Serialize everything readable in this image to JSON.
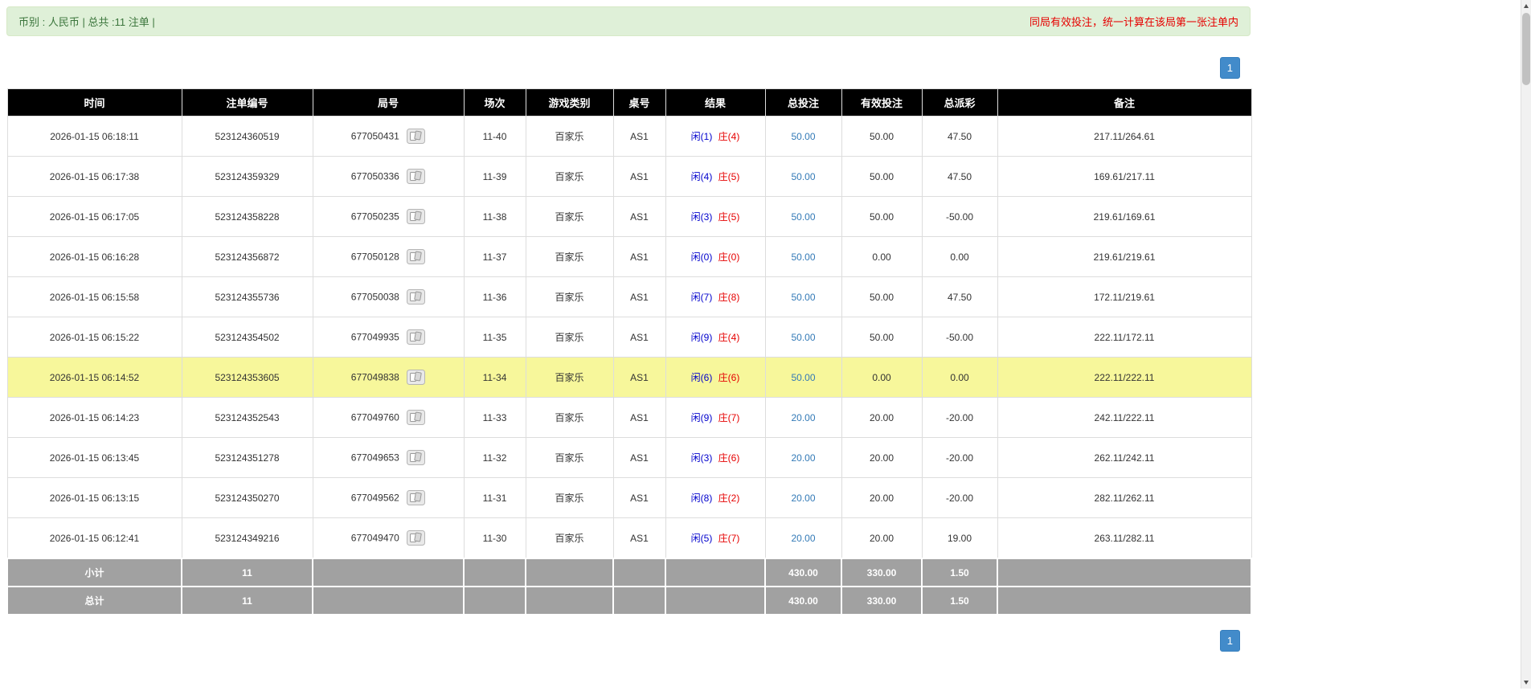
{
  "colors": {
    "topbar_bg": "#dff0d8",
    "topbar_border": "#d6e9c6",
    "topbar_text_green": "#3c763d",
    "notice_red": "#e60000",
    "pagination_blue": "#428bca",
    "header_bg": "#000000",
    "highlight_yellow": "#f7f79b",
    "player_blue": "#0000cc",
    "banker_red": "#e60000",
    "bet_link_blue": "#337ab7",
    "negative_red": "#e60000",
    "summary_gray": "#a1a1a1"
  },
  "topbar": {
    "summary": "币别 : 人民币 | 总共 :11 注单 |",
    "notice": "同局有效投注，统一计算在该局第一张注单内"
  },
  "pagination": {
    "page": "1"
  },
  "table": {
    "headers": [
      "时间",
      "注单编号",
      "局号",
      "场次",
      "游戏类别",
      "桌号",
      "结果",
      "总投注",
      "有效投注",
      "总派彩",
      "备注"
    ],
    "rows": [
      {
        "time": "2026-01-15 06:18:11",
        "bet_id": "523124360519",
        "round": "677050431",
        "session": "11-40",
        "game": "百家乐",
        "table_no": "AS1",
        "result_player": "闲(1)",
        "result_banker": "庄(4)",
        "total_bet": "50.00",
        "valid_bet": "50.00",
        "payout": "47.50",
        "remark": "217.11/264.61",
        "highlight": false
      },
      {
        "time": "2026-01-15 06:17:38",
        "bet_id": "523124359329",
        "round": "677050336",
        "session": "11-39",
        "game": "百家乐",
        "table_no": "AS1",
        "result_player": "闲(4)",
        "result_banker": "庄(5)",
        "total_bet": "50.00",
        "valid_bet": "50.00",
        "payout": "47.50",
        "remark": "169.61/217.11",
        "highlight": false
      },
      {
        "time": "2026-01-15 06:17:05",
        "bet_id": "523124358228",
        "round": "677050235",
        "session": "11-38",
        "game": "百家乐",
        "table_no": "AS1",
        "result_player": "闲(3)",
        "result_banker": "庄(5)",
        "total_bet": "50.00",
        "valid_bet": "50.00",
        "payout": "-50.00",
        "remark": "219.61/169.61",
        "highlight": false
      },
      {
        "time": "2026-01-15 06:16:28",
        "bet_id": "523124356872",
        "round": "677050128",
        "session": "11-37",
        "game": "百家乐",
        "table_no": "AS1",
        "result_player": "闲(0)",
        "result_banker": "庄(0)",
        "total_bet": "50.00",
        "valid_bet": "0.00",
        "payout": "0.00",
        "remark": "219.61/219.61",
        "highlight": false
      },
      {
        "time": "2026-01-15 06:15:58",
        "bet_id": "523124355736",
        "round": "677050038",
        "session": "11-36",
        "game": "百家乐",
        "table_no": "AS1",
        "result_player": "闲(7)",
        "result_banker": "庄(8)",
        "total_bet": "50.00",
        "valid_bet": "50.00",
        "payout": "47.50",
        "remark": "172.11/219.61",
        "highlight": false
      },
      {
        "time": "2026-01-15 06:15:22",
        "bet_id": "523124354502",
        "round": "677049935",
        "session": "11-35",
        "game": "百家乐",
        "table_no": "AS1",
        "result_player": "闲(9)",
        "result_banker": "庄(4)",
        "total_bet": "50.00",
        "valid_bet": "50.00",
        "payout": "-50.00",
        "remark": "222.11/172.11",
        "highlight": false
      },
      {
        "time": "2026-01-15 06:14:52",
        "bet_id": "523124353605",
        "round": "677049838",
        "session": "11-34",
        "game": "百家乐",
        "table_no": "AS1",
        "result_player": "闲(6)",
        "result_banker": "庄(6)",
        "total_bet": "50.00",
        "valid_bet": "0.00",
        "payout": "0.00",
        "remark": "222.11/222.11",
        "highlight": true
      },
      {
        "time": "2026-01-15 06:14:23",
        "bet_id": "523124352543",
        "round": "677049760",
        "session": "11-33",
        "game": "百家乐",
        "table_no": "AS1",
        "result_player": "闲(9)",
        "result_banker": "庄(7)",
        "total_bet": "20.00",
        "valid_bet": "20.00",
        "payout": "-20.00",
        "remark": "242.11/222.11",
        "highlight": false
      },
      {
        "time": "2026-01-15 06:13:45",
        "bet_id": "523124351278",
        "round": "677049653",
        "session": "11-32",
        "game": "百家乐",
        "table_no": "AS1",
        "result_player": "闲(3)",
        "result_banker": "庄(6)",
        "total_bet": "20.00",
        "valid_bet": "20.00",
        "payout": "-20.00",
        "remark": "262.11/242.11",
        "highlight": false
      },
      {
        "time": "2026-01-15 06:13:15",
        "bet_id": "523124350270",
        "round": "677049562",
        "session": "11-31",
        "game": "百家乐",
        "table_no": "AS1",
        "result_player": "闲(8)",
        "result_banker": "庄(2)",
        "total_bet": "20.00",
        "valid_bet": "20.00",
        "payout": "-20.00",
        "remark": "282.11/262.11",
        "highlight": false
      },
      {
        "time": "2026-01-15 06:12:41",
        "bet_id": "523124349216",
        "round": "677049470",
        "session": "11-30",
        "game": "百家乐",
        "table_no": "AS1",
        "result_player": "闲(5)",
        "result_banker": "庄(7)",
        "total_bet": "20.00",
        "valid_bet": "20.00",
        "payout": "19.00",
        "remark": "263.11/282.11",
        "highlight": false
      }
    ],
    "subtotal": {
      "label": "小计",
      "count": "11",
      "total_bet": "430.00",
      "valid_bet": "330.00",
      "payout": "1.50"
    },
    "total": {
      "label": "总计",
      "count": "11",
      "total_bet": "430.00",
      "valid_bet": "330.00",
      "payout": "1.50"
    }
  }
}
